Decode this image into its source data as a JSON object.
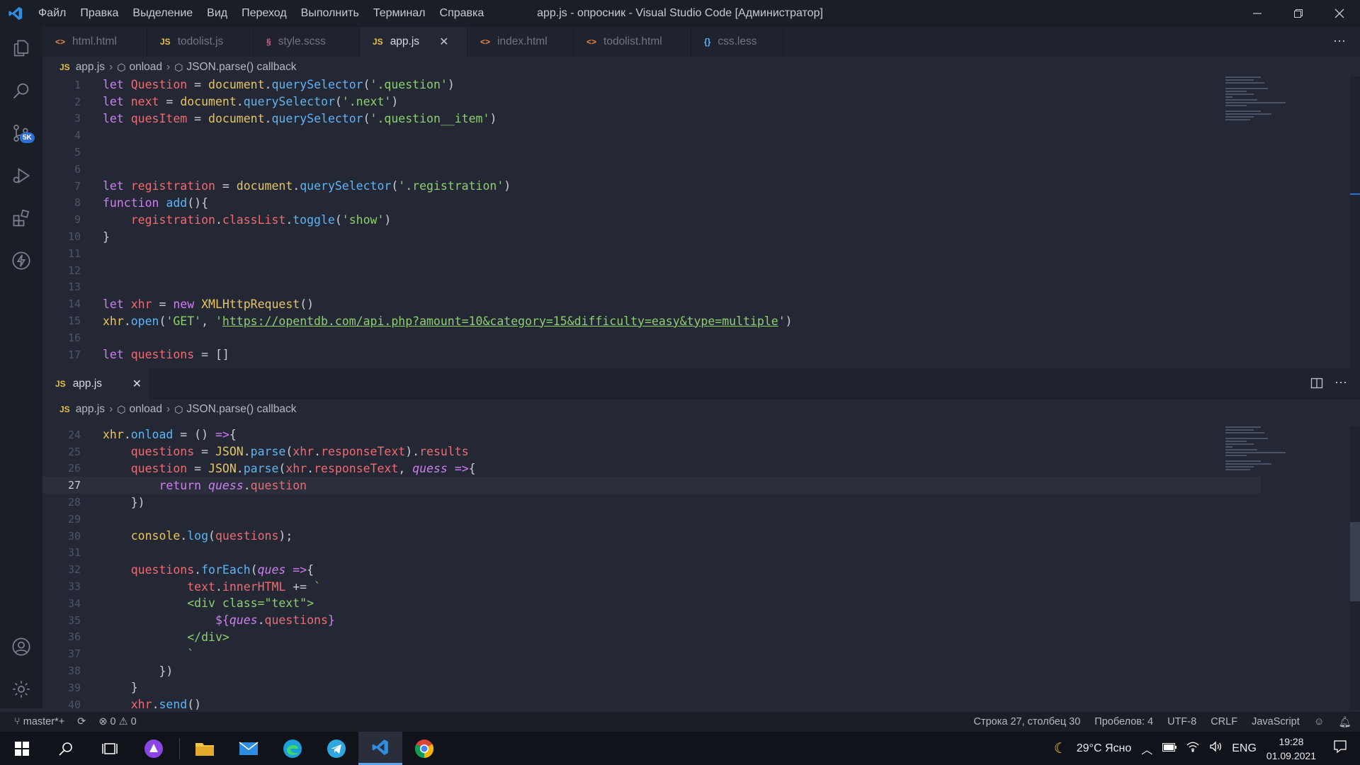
{
  "window": {
    "title": "app.js - опросник - Visual Studio Code [Администратор]",
    "menu": [
      "Файл",
      "Правка",
      "Выделение",
      "Вид",
      "Переход",
      "Выполнить",
      "Терминал",
      "Справка"
    ]
  },
  "tabs": [
    {
      "label": "html.html",
      "icon": "html-icon",
      "glyph": "<>",
      "color": "#e8874a"
    },
    {
      "label": "todolist.js",
      "icon": "js-icon",
      "glyph": "JS",
      "color": "#e6c045"
    },
    {
      "label": "style.scss",
      "icon": "scss-icon",
      "glyph": "§",
      "color": "#e05c8a"
    },
    {
      "label": "app.js",
      "icon": "js-icon",
      "glyph": "JS",
      "color": "#e6c045",
      "active": true
    },
    {
      "label": "index.html",
      "icon": "html-icon",
      "glyph": "<>",
      "color": "#e8874a"
    },
    {
      "label": "todolist.html",
      "icon": "html-icon",
      "glyph": "<>",
      "color": "#e8874a"
    },
    {
      "label": "css.less",
      "icon": "less-icon",
      "glyph": "{}",
      "color": "#5fb4f5"
    }
  ],
  "breadcrumb": {
    "file": "app.js",
    "symbol1": "onload",
    "symbol2": "JSON.parse() callback"
  },
  "activity_badge": "5K",
  "split_tab": {
    "label": "app.js"
  },
  "top_line_numbers": [
    "1",
    "2",
    "3",
    "4",
    "5",
    "6",
    "7",
    "8",
    "9",
    "10",
    "11",
    "12",
    "13",
    "14",
    "15",
    "16",
    "17"
  ],
  "bottom_line_numbers": [
    "24",
    "25",
    "26",
    "27",
    "28",
    "29",
    "30",
    "31",
    "32",
    "33",
    "34",
    "35",
    "36",
    "37",
    "38",
    "39",
    "40"
  ],
  "status": {
    "branch": "master*+",
    "errors": "0",
    "warnings": "0",
    "position": "Строка 27, столбец 30",
    "spaces": "Пробелов: 4",
    "encoding": "UTF-8",
    "eol": "CRLF",
    "language": "JavaScript"
  },
  "tray": {
    "weather": "29°C Ясно",
    "lang": "ENG",
    "time": "19:28",
    "date": "01.09.2021"
  },
  "colors": {
    "accent": "#2d6fd6",
    "js": "#e6c045",
    "string": "#8ecf6e",
    "variable": "#ef6b73",
    "function": "#5fb4f5",
    "keyword": "#d07ef0"
  }
}
